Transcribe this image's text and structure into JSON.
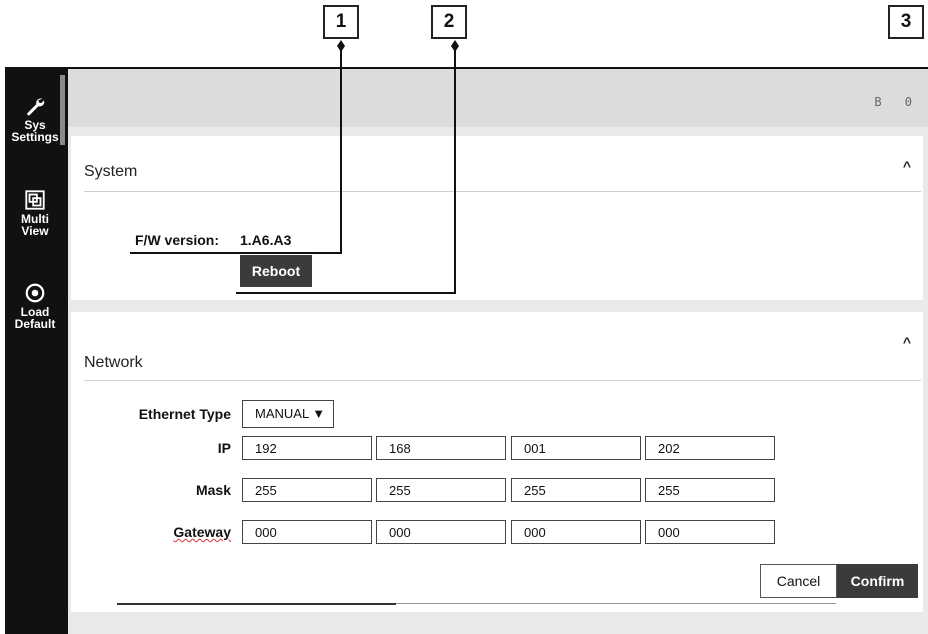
{
  "callouts": [
    "1",
    "2",
    "3"
  ],
  "sidebar": {
    "items": [
      {
        "label": "Sys\nSettings",
        "icon": "wrench-icon"
      },
      {
        "label": "Multi\nView",
        "icon": "multiview-icon"
      },
      {
        "label": "Load\nDefault",
        "icon": "target-icon"
      }
    ]
  },
  "topbar": {
    "icons": "B 0"
  },
  "system": {
    "title": "System",
    "chevron": "^",
    "fw_label": "F/W version:",
    "fw_value": "1.A6.A3",
    "reboot_label": "Reboot"
  },
  "network": {
    "title": "Network",
    "chevron": "^",
    "ethernet_label": "Ethernet Type",
    "ethernet_value": "MANUAL ▼",
    "ip_label": "IP",
    "ip": [
      "192",
      "168",
      "001",
      "202"
    ],
    "mask_label": "Mask",
    "mask": [
      "255",
      "255",
      "255",
      "255"
    ],
    "gateway_label": "Gateway",
    "gateway": [
      "000",
      "000",
      "000",
      "000"
    ],
    "cancel_label": "Cancel",
    "confirm_label": "Confirm"
  },
  "colors": {
    "sidebar": "#111111",
    "panel": "#e9e9e9",
    "button_dark": "#3b3b3b"
  }
}
